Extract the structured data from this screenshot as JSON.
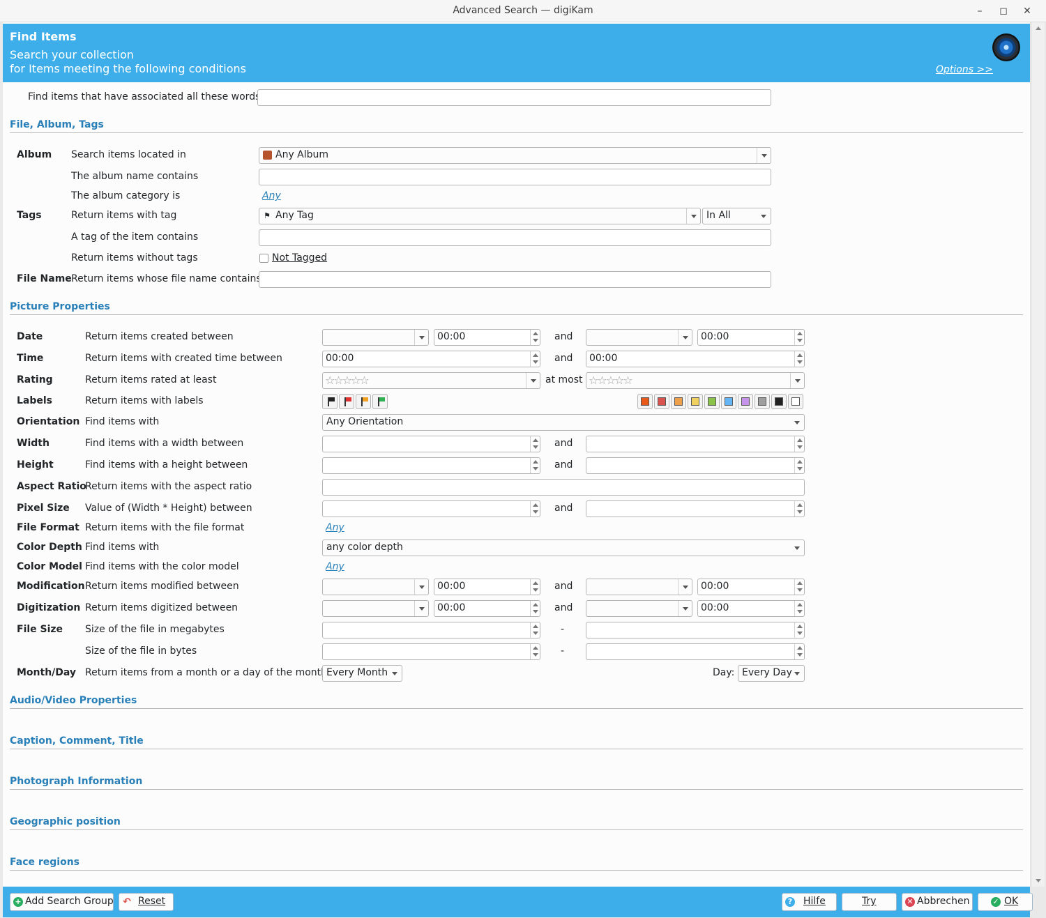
{
  "window": {
    "title": "Advanced Search — digiKam"
  },
  "header": {
    "title": "Find Items",
    "line1": "Search your collection",
    "line2": "for Items meeting the following conditions",
    "options": "Options >>"
  },
  "keywords": {
    "label": "Find items that have associated all these words:",
    "value": ""
  },
  "sections": {
    "file_album_tags": "File, Album, Tags",
    "picture": "Picture Properties",
    "audio_video": "Audio/Video Properties",
    "caption": "Caption, Comment, Title",
    "photo_info": "Photograph Information",
    "geo": "Geographic position",
    "faces": "Face regions"
  },
  "album": {
    "group": "Album",
    "located_label": "Search items located in",
    "located_value": "Any Album",
    "name_label": "The album name contains",
    "category_label": "The album category is",
    "category_value": "Any"
  },
  "tags": {
    "group": "Tags",
    "with_tag_label": "Return items with tag",
    "with_tag_value": "Any Tag",
    "match_value": "In All",
    "contains_label": "A tag of the item contains",
    "without_label": "Return items without tags",
    "not_tagged": "Not Tagged"
  },
  "filename": {
    "group": "File Name",
    "label": "Return items whose file name contains"
  },
  "picture": {
    "date_group": "Date",
    "date_label": "Return items created between",
    "time_group": "Time",
    "time_label": "Return items with created time between",
    "rating_group": "Rating",
    "rating_label": "Return items rated at least",
    "at_most": "at most",
    "labels_group": "Labels",
    "labels_label": "Return items with labels",
    "orientation_group": "Orientation",
    "orientation_label": "Find items with",
    "orientation_value": "Any Orientation",
    "width_group": "Width",
    "width_label": "Find items with a width between",
    "height_group": "Height",
    "height_label": "Find items with a height between",
    "aspect_group": "Aspect Ratio",
    "aspect_label": "Return items with the aspect ratio",
    "pixel_group": "Pixel Size",
    "pixel_label": "Value of (Width * Height) between",
    "format_group": "File Format",
    "format_label": "Return items with the file format",
    "format_value": "Any",
    "depth_group": "Color Depth",
    "depth_label": "Find items with",
    "depth_value": "any color depth",
    "model_group": "Color Model",
    "model_label": "Find items with the color model",
    "model_value": "Any",
    "mod_group": "Modification",
    "mod_label": "Return items modified between",
    "dig_group": "Digitization",
    "dig_label": "Return items digitized between",
    "size_group": "File Size",
    "size_mb_label": "Size of the file in megabytes",
    "size_b_label": "Size of the file in bytes",
    "month_group": "Month/Day",
    "month_label": "Return items from a month or a day of the month",
    "month_value": "Every Month",
    "day_label": "Day:",
    "day_value": "Every Day",
    "and": "and",
    "dash": "-",
    "time_zero": "00:00",
    "stars": "☆☆☆☆☆"
  },
  "color_labels": [
    "#e8591a",
    "#d9534f",
    "#f0a04b",
    "#f0d060",
    "#8bc34a",
    "#64b5f6",
    "#c792ea",
    "#9e9e9e",
    "#222222",
    "#ffffff"
  ],
  "footer": {
    "add_group": "Add Search Group",
    "reset": "Reset",
    "help": "Hilfe",
    "try": "Try",
    "cancel": "Abbrechen",
    "ok": "OK"
  }
}
